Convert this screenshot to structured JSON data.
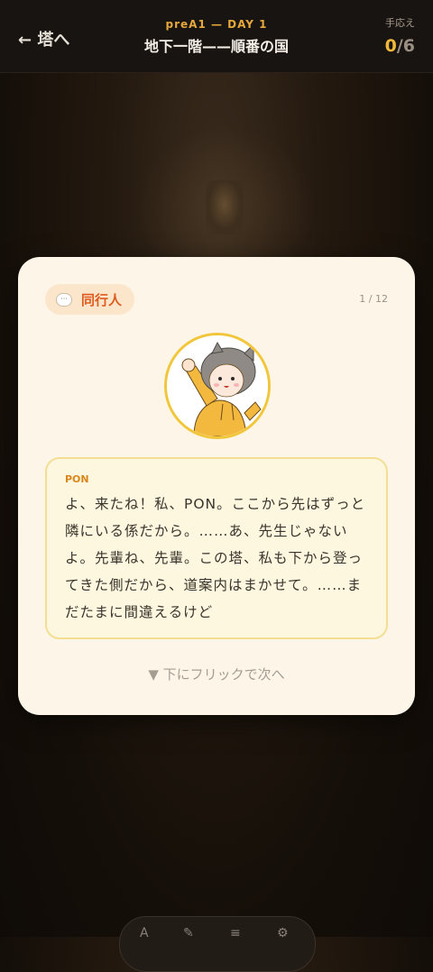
{
  "header": {
    "back_label": "← 塔へ",
    "subtitle": "preA1 — DAY 1",
    "title": "地下一階——順番の国",
    "score_label": "手応え",
    "score_current": "0",
    "score_total": "/6"
  },
  "card": {
    "badge_label": "同行人",
    "counter": "1 / 12",
    "speaker": "PON",
    "dialogue": "よ、来たね！私、PON。ここから先はずっと隣にいる係だから。……あ、先生じゃないよ。先輩ね、先輩。この塔、私も下から登ってきた側だから、道案内はまかせて。……まだたまに間違えるけど",
    "hint": "下にフリックで次へ"
  },
  "colors": {
    "accent": "#e5a83a",
    "badge_text": "#e05a1e",
    "card_bg": "#fdf6e8",
    "speech_border": "#f3df94"
  }
}
